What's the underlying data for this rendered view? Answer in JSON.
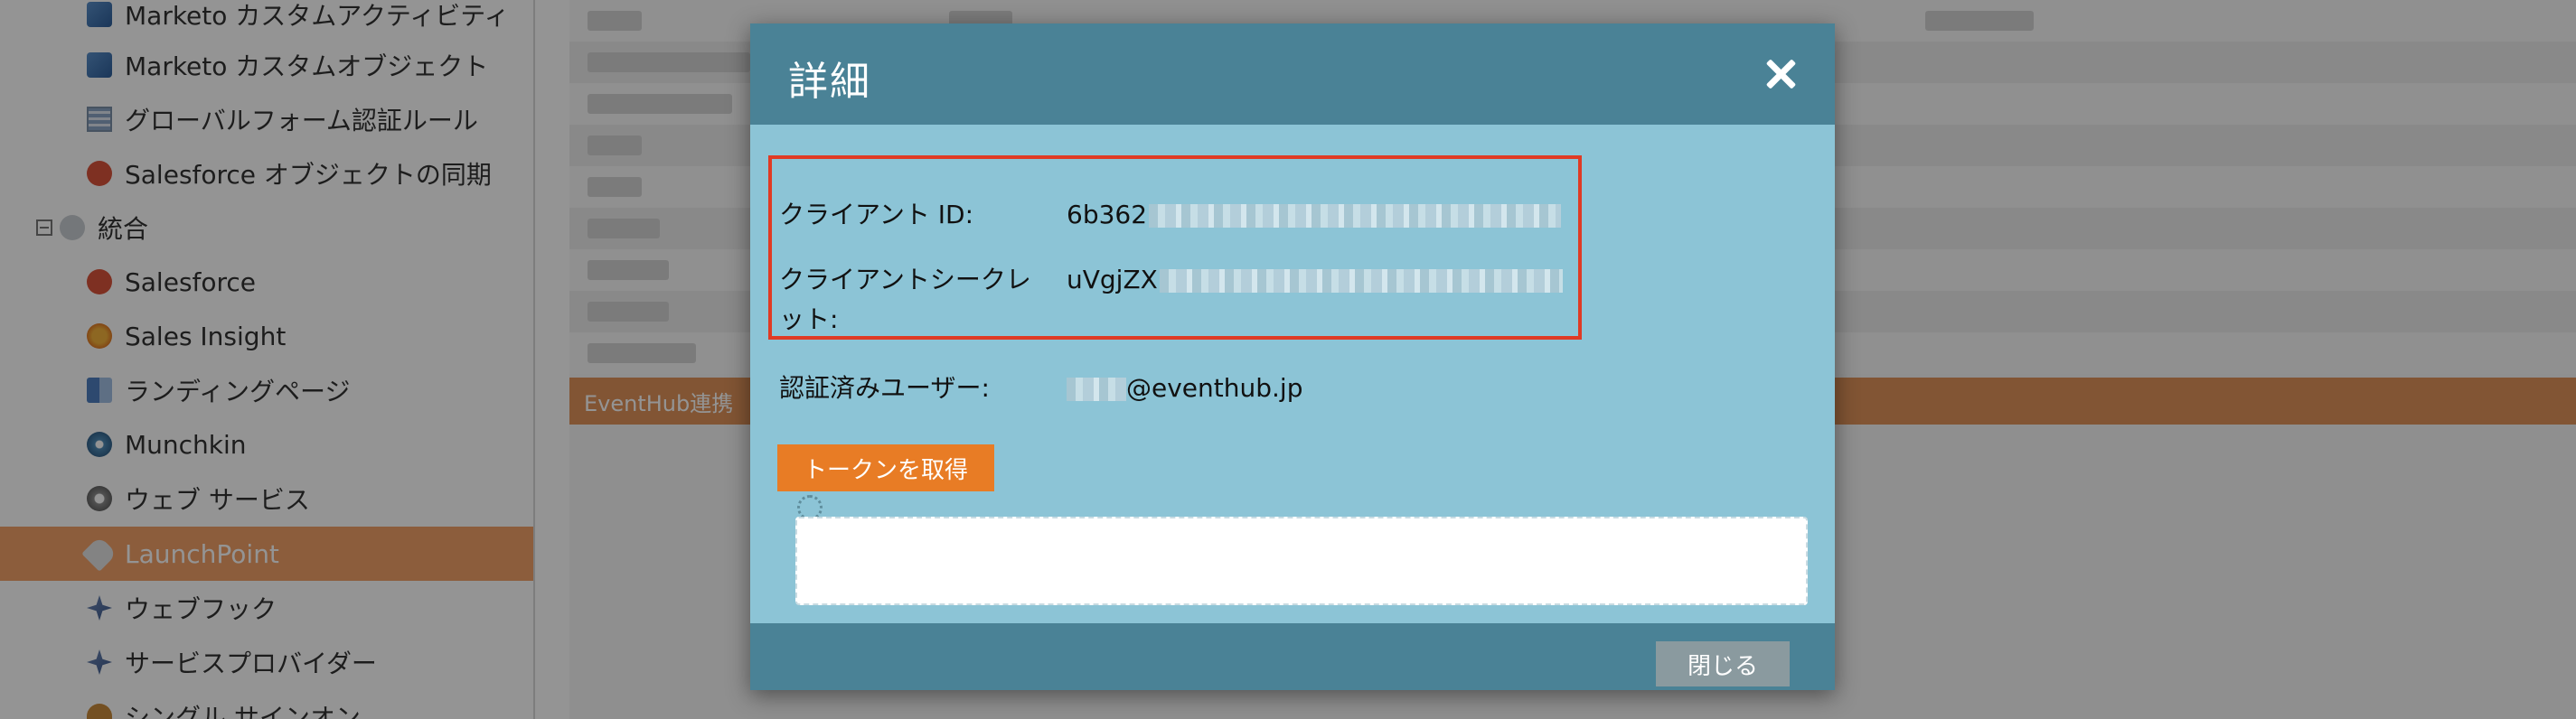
{
  "sidebar": {
    "items": [
      {
        "label": "Marketo カスタムアクティビティ",
        "icon": "custom-activity-icon"
      },
      {
        "label": "Marketo カスタムオブジェクト",
        "icon": "custom-object-icon"
      },
      {
        "label": "グローバルフォーム認証ルール",
        "icon": "form-rule-icon"
      },
      {
        "label": "Salesforce オブジェクトの同期",
        "icon": "salesforce-sync-icon"
      },
      {
        "label": "統合",
        "icon": "cloud-icon"
      },
      {
        "label": "Salesforce",
        "icon": "salesforce-icon"
      },
      {
        "label": "Sales Insight",
        "icon": "sales-insight-icon"
      },
      {
        "label": "ランディングページ",
        "icon": "landing-page-icon"
      },
      {
        "label": "Munchkin",
        "icon": "munchkin-icon"
      },
      {
        "label": "ウェブ サービス",
        "icon": "web-services-icon"
      },
      {
        "label": "LaunchPoint",
        "icon": "launchpoint-icon"
      },
      {
        "label": "ウェブフック",
        "icon": "webhook-icon"
      },
      {
        "label": "サービスプロバイダー",
        "icon": "service-provider-icon"
      },
      {
        "label": "シングル サインオン",
        "icon": "single-sign-on-icon"
      }
    ],
    "active_label": "LaunchPoint"
  },
  "main": {
    "section_bar": "EventHub連携"
  },
  "modal": {
    "title": "詳細",
    "client_id_label": "クライアント ID:",
    "client_id_value": "6b362",
    "client_secret_label": "クライアントシークレット:",
    "client_secret_value": "uVgjZX",
    "auth_user_label": "認証済みユーザー:",
    "auth_user_value": "@eventhub.jp",
    "token_button": "トークンを取得",
    "token_output": "",
    "close_button": "閉じる"
  },
  "colors": {
    "modal_header": "#4a8296",
    "modal_body": "#8cc4d6",
    "highlight_border": "#e03a24",
    "token_button": "#e87c25",
    "close_button": "#8a9a9f",
    "active_nav": "#f1a068"
  }
}
